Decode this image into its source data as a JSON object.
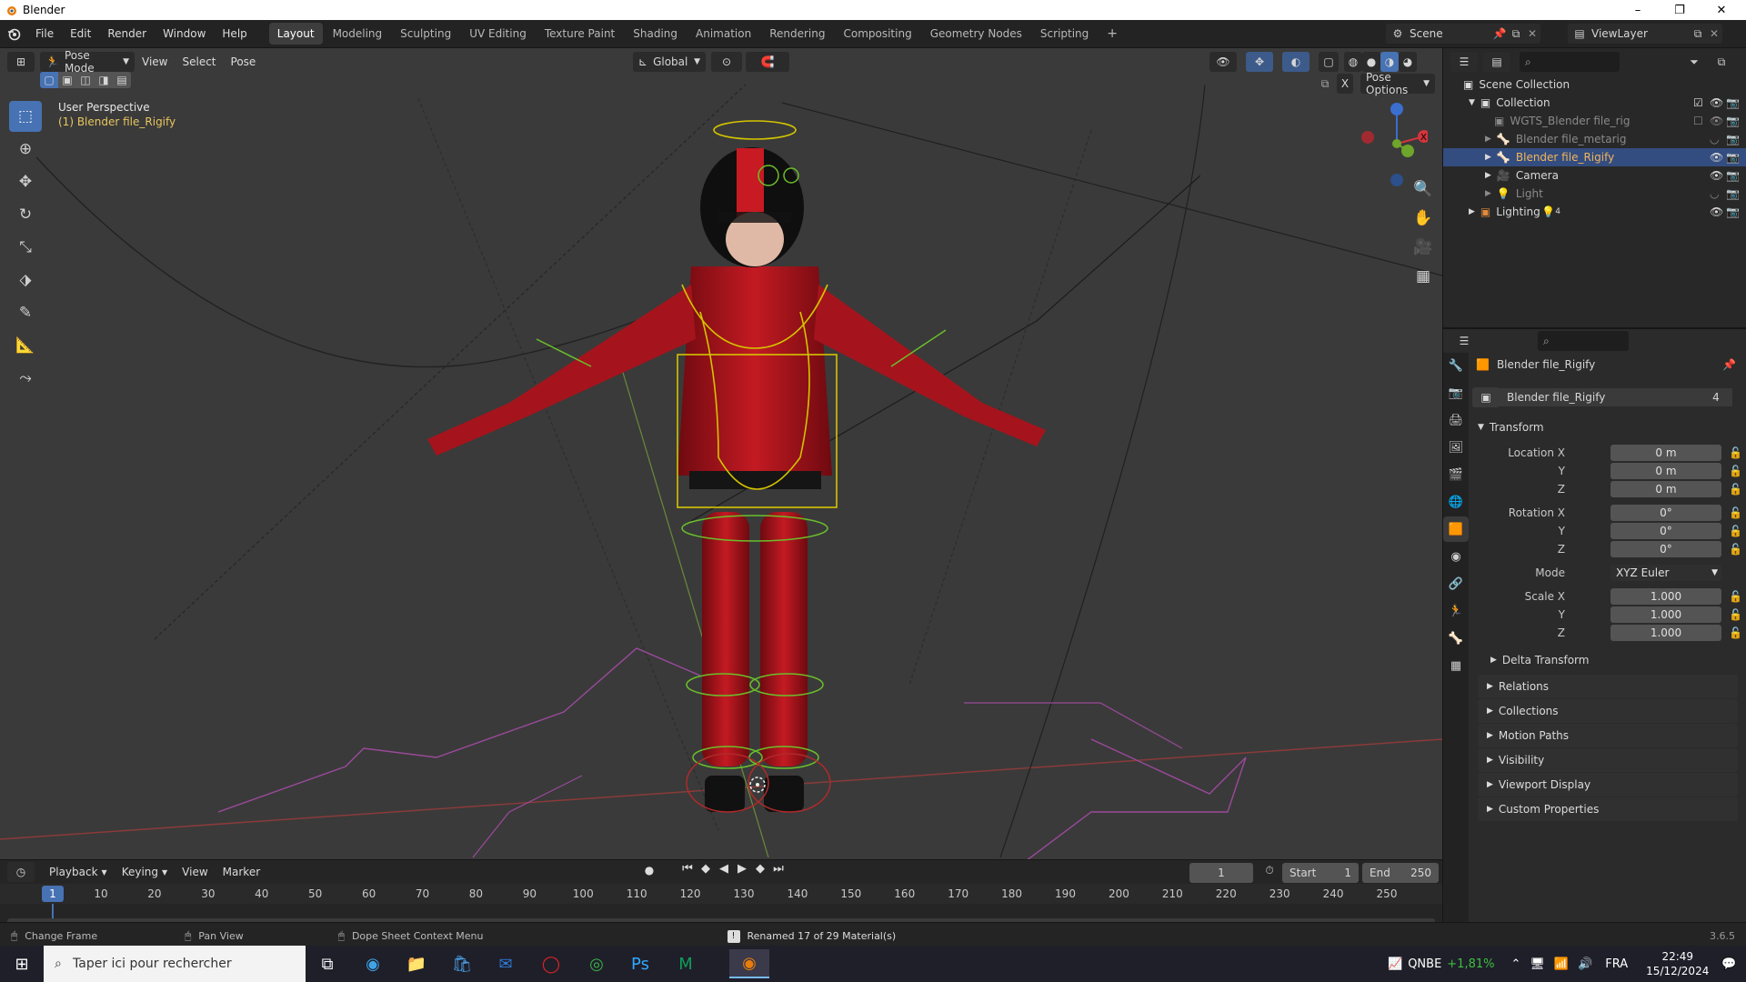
{
  "window": {
    "title": "Blender"
  },
  "menu": [
    "File",
    "Edit",
    "Render",
    "Window",
    "Help"
  ],
  "workspaces": {
    "tabs": [
      "Layout",
      "Modeling",
      "Sculpting",
      "UV Editing",
      "Texture Paint",
      "Shading",
      "Animation",
      "Rendering",
      "Compositing",
      "Geometry Nodes",
      "Scripting"
    ],
    "active": "Layout",
    "add": "+"
  },
  "scene": {
    "name": "Scene",
    "view_layer": "ViewLayer"
  },
  "viewport": {
    "mode": "Pose Mode",
    "menus": [
      "View",
      "Select",
      "Pose"
    ],
    "orientation": "Global",
    "pose_options": "Pose Options",
    "overlay_title": "User Perspective",
    "overlay_subtitle": "(1) Blender file_Rigify",
    "x_axis": "X"
  },
  "outliner": {
    "root": "Scene Collection",
    "items": [
      {
        "label": "Collection",
        "indent": 1,
        "selected": false,
        "muted": false
      },
      {
        "label": "WGTS_Blender file_rig",
        "indent": 2,
        "selected": false,
        "muted": true
      },
      {
        "label": "Blender file_metarig",
        "indent": 2,
        "selected": false,
        "muted": true
      },
      {
        "label": "Blender file_Rigify",
        "indent": 2,
        "selected": true,
        "muted": false
      },
      {
        "label": "Camera",
        "indent": 2,
        "selected": false,
        "muted": false
      },
      {
        "label": "Light",
        "indent": 2,
        "selected": false,
        "muted": true
      },
      {
        "label": "Lighting",
        "indent": 1,
        "selected": false,
        "muted": false
      }
    ],
    "lighting_count": "4"
  },
  "properties": {
    "object_name": "Blender file_Rigify",
    "data_name": "Blender file_Rigify",
    "user_count": "4",
    "transform_header": "Transform",
    "location_label": "Location X",
    "rotation_label": "Rotation X",
    "scale_label": "Scale X",
    "y_label": "Y",
    "z_label": "Z",
    "mode_label": "Mode",
    "location": [
      "0 m",
      "0 m",
      "0 m"
    ],
    "rotation": [
      "0°",
      "0°",
      "0°"
    ],
    "mode": "XYZ Euler",
    "scale": [
      "1.000",
      "1.000",
      "1.000"
    ],
    "delta_transform": "Delta Transform",
    "panels": [
      "Relations",
      "Collections",
      "Motion Paths",
      "Visibility",
      "Viewport Display",
      "Custom Properties"
    ]
  },
  "timeline": {
    "menus": [
      "Playback",
      "Keying",
      "View",
      "Marker"
    ],
    "current_frame": "1",
    "start_label": "Start",
    "start": "1",
    "end_label": "End",
    "end": "250",
    "ticks": [
      "1",
      "10",
      "20",
      "30",
      "40",
      "50",
      "60",
      "70",
      "80",
      "90",
      "100",
      "110",
      "120",
      "130",
      "140",
      "150",
      "160",
      "170",
      "180",
      "190",
      "200",
      "210",
      "220",
      "230",
      "240",
      "250"
    ]
  },
  "status": {
    "hint1": "Change Frame",
    "hint2": "Pan View",
    "hint3": "Dope Sheet Context Menu",
    "message": "Renamed 17 of 29 Material(s)",
    "version": "3.6.5"
  },
  "taskbar": {
    "search_placeholder": "Taper ici pour rechercher",
    "stock_name": "QNBE",
    "stock_change": "+1,81%",
    "lang": "FRA",
    "time": "22:49",
    "date": "15/12/2024"
  },
  "colors": {
    "accent": "#4772b3",
    "selected_row": "#334d80",
    "timeline_cursor": "#4772b3",
    "stock_up": "#3fbf3f",
    "suit_red": "#b3121a"
  }
}
